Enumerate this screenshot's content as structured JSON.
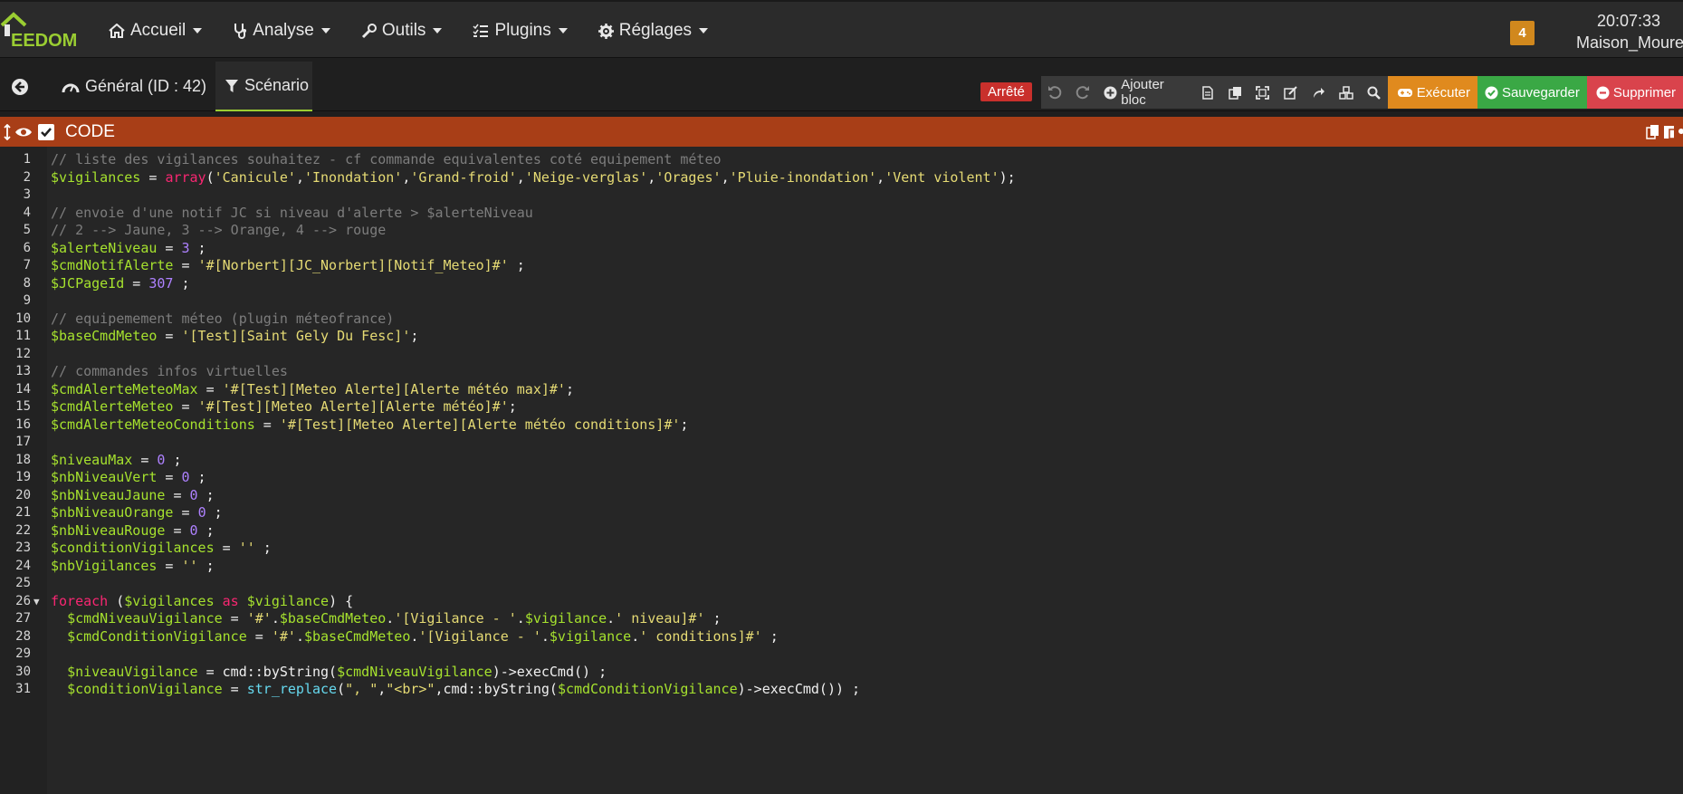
{
  "brand": {
    "logo_text": "EEDOM"
  },
  "nav": {
    "items": [
      {
        "label": "Accueil",
        "icon": "home-icon"
      },
      {
        "label": "Analyse",
        "icon": "stethoscope-icon"
      },
      {
        "label": "Outils",
        "icon": "wrench-icon"
      },
      {
        "label": "Plugins",
        "icon": "tasks-icon"
      },
      {
        "label": "Réglages",
        "icon": "cog-icon"
      }
    ],
    "message_count": "4",
    "time": "20:07:33",
    "hostname": "Maison_Moure"
  },
  "tabs": {
    "general": "Général (ID : 42)",
    "scenario": "Scénario"
  },
  "toolbar": {
    "status": "Arrêté",
    "add_block": "Ajouter bloc",
    "execute": "Exécuter",
    "save": "Sauvegarder",
    "delete": "Supprimer"
  },
  "block": {
    "title": "CODE"
  },
  "colors": {
    "comment": "#7d7d7d",
    "variable": "#a6e22e",
    "string": "#e6db74",
    "number": "#ae81ff",
    "keyword": "#f92672",
    "function": "#66d9ef",
    "header": "#a83e17",
    "execute": "#e08a1e",
    "save": "#3aa845",
    "delete": "#d9434c"
  },
  "code_lines": [
    [
      [
        "c",
        "// liste des vigilances souhaitez - cf commande equivalentes coté equipement méteo"
      ]
    ],
    [
      [
        "v",
        "$vigilances"
      ],
      [
        "p",
        " = "
      ],
      [
        "k",
        "array"
      ],
      [
        "p",
        "("
      ],
      [
        "s",
        "'Canicule'"
      ],
      [
        "p",
        ","
      ],
      [
        "s",
        "'Inondation'"
      ],
      [
        "p",
        ","
      ],
      [
        "s",
        "'Grand-froid'"
      ],
      [
        "p",
        ","
      ],
      [
        "s",
        "'Neige-verglas'"
      ],
      [
        "p",
        ","
      ],
      [
        "s",
        "'Orages'"
      ],
      [
        "p",
        ","
      ],
      [
        "s",
        "'Pluie-inondation'"
      ],
      [
        "p",
        ","
      ],
      [
        "s",
        "'Vent violent'"
      ],
      [
        "p",
        ");"
      ]
    ],
    [],
    [
      [
        "c",
        "// envoie d'une notif JC si niveau d'alerte > $alerteNiveau"
      ]
    ],
    [
      [
        "c",
        "// 2 --> Jaune, 3 --> Orange, 4 --> rouge"
      ]
    ],
    [
      [
        "v",
        "$alerteNiveau"
      ],
      [
        "p",
        " = "
      ],
      [
        "n",
        "3"
      ],
      [
        "p",
        " ;"
      ]
    ],
    [
      [
        "v",
        "$cmdNotifAlerte"
      ],
      [
        "p",
        " = "
      ],
      [
        "s",
        "'#[Norbert][JC_Norbert][Notif_Meteo]#'"
      ],
      [
        "p",
        " ;"
      ]
    ],
    [
      [
        "v",
        "$JCPageId"
      ],
      [
        "p",
        " = "
      ],
      [
        "n",
        "307"
      ],
      [
        "p",
        " ;"
      ]
    ],
    [],
    [
      [
        "c",
        "// equipemement méteo (plugin méteofrance)"
      ]
    ],
    [
      [
        "v",
        "$baseCmdMeteo"
      ],
      [
        "p",
        " = "
      ],
      [
        "s",
        "'[Test][Saint Gely Du Fesc]'"
      ],
      [
        "p",
        ";"
      ]
    ],
    [],
    [
      [
        "c",
        "// commandes infos virtuelles"
      ]
    ],
    [
      [
        "v",
        "$cmdAlerteMeteoMax"
      ],
      [
        "p",
        " = "
      ],
      [
        "s",
        "'#[Test][Meteo Alerte][Alerte météo max]#'"
      ],
      [
        "p",
        ";"
      ]
    ],
    [
      [
        "v",
        "$cmdAlerteMeteo"
      ],
      [
        "p",
        " = "
      ],
      [
        "s",
        "'#[Test][Meteo Alerte][Alerte météo]#'"
      ],
      [
        "p",
        ";"
      ]
    ],
    [
      [
        "v",
        "$cmdAlerteMeteoConditions"
      ],
      [
        "p",
        " = "
      ],
      [
        "s",
        "'#[Test][Meteo Alerte][Alerte météo conditions]#'"
      ],
      [
        "p",
        ";"
      ]
    ],
    [],
    [
      [
        "v",
        "$niveauMax"
      ],
      [
        "p",
        " = "
      ],
      [
        "n",
        "0"
      ],
      [
        "p",
        " ;"
      ]
    ],
    [
      [
        "v",
        "$nbNiveauVert"
      ],
      [
        "p",
        " = "
      ],
      [
        "n",
        "0"
      ],
      [
        "p",
        " ;"
      ]
    ],
    [
      [
        "v",
        "$nbNiveauJaune"
      ],
      [
        "p",
        " = "
      ],
      [
        "n",
        "0"
      ],
      [
        "p",
        " ;"
      ]
    ],
    [
      [
        "v",
        "$nbNiveauOrange"
      ],
      [
        "p",
        " = "
      ],
      [
        "n",
        "0"
      ],
      [
        "p",
        " ;"
      ]
    ],
    [
      [
        "v",
        "$nbNiveauRouge"
      ],
      [
        "p",
        " = "
      ],
      [
        "n",
        "0"
      ],
      [
        "p",
        " ;"
      ]
    ],
    [
      [
        "v",
        "$conditionVigilances"
      ],
      [
        "p",
        " = "
      ],
      [
        "s",
        "''"
      ],
      [
        "p",
        " ;"
      ]
    ],
    [
      [
        "v",
        "$nbVigilances"
      ],
      [
        "p",
        " = "
      ],
      [
        "s",
        "''"
      ],
      [
        "p",
        " ;"
      ]
    ],
    [],
    [
      [
        "k",
        "foreach"
      ],
      [
        "p",
        " ("
      ],
      [
        "v",
        "$vigilances"
      ],
      [
        "p",
        " "
      ],
      [
        "k",
        "as"
      ],
      [
        "p",
        " "
      ],
      [
        "v",
        "$vigilance"
      ],
      [
        "p",
        ") {"
      ]
    ],
    [
      [
        "p",
        "  "
      ],
      [
        "v",
        "$cmdNiveauVigilance"
      ],
      [
        "p",
        " = "
      ],
      [
        "s",
        "'#'"
      ],
      [
        "p",
        "."
      ],
      [
        "v",
        "$baseCmdMeteo"
      ],
      [
        "p",
        "."
      ],
      [
        "s",
        "'[Vigilance - '"
      ],
      [
        "p",
        "."
      ],
      [
        "v",
        "$vigilance"
      ],
      [
        "p",
        "."
      ],
      [
        "s",
        "' niveau]#'"
      ],
      [
        "p",
        " ;"
      ]
    ],
    [
      [
        "p",
        "  "
      ],
      [
        "v",
        "$cmdConditionVigilance"
      ],
      [
        "p",
        " = "
      ],
      [
        "s",
        "'#'"
      ],
      [
        "p",
        "."
      ],
      [
        "v",
        "$baseCmdMeteo"
      ],
      [
        "p",
        "."
      ],
      [
        "s",
        "'[Vigilance - '"
      ],
      [
        "p",
        "."
      ],
      [
        "v",
        "$vigilance"
      ],
      [
        "p",
        "."
      ],
      [
        "s",
        "' conditions]#'"
      ],
      [
        "p",
        " ;"
      ]
    ],
    [],
    [
      [
        "p",
        "  "
      ],
      [
        "v",
        "$niveauVigilance"
      ],
      [
        "p",
        " = cmd::byString("
      ],
      [
        "v",
        "$cmdNiveauVigilance"
      ],
      [
        "p",
        ")->execCmd() ;"
      ]
    ],
    [
      [
        "p",
        "  "
      ],
      [
        "v",
        "$conditionVigilance"
      ],
      [
        "p",
        " = "
      ],
      [
        "f",
        "str_replace"
      ],
      [
        "p",
        "("
      ],
      [
        "s",
        "\", \""
      ],
      [
        "p",
        ","
      ],
      [
        "s",
        "\"<br>\""
      ],
      [
        "p",
        ",cmd::byString("
      ],
      [
        "v",
        "$cmdConditionVigilance"
      ],
      [
        "p",
        ")->execCmd()) ;"
      ]
    ]
  ]
}
